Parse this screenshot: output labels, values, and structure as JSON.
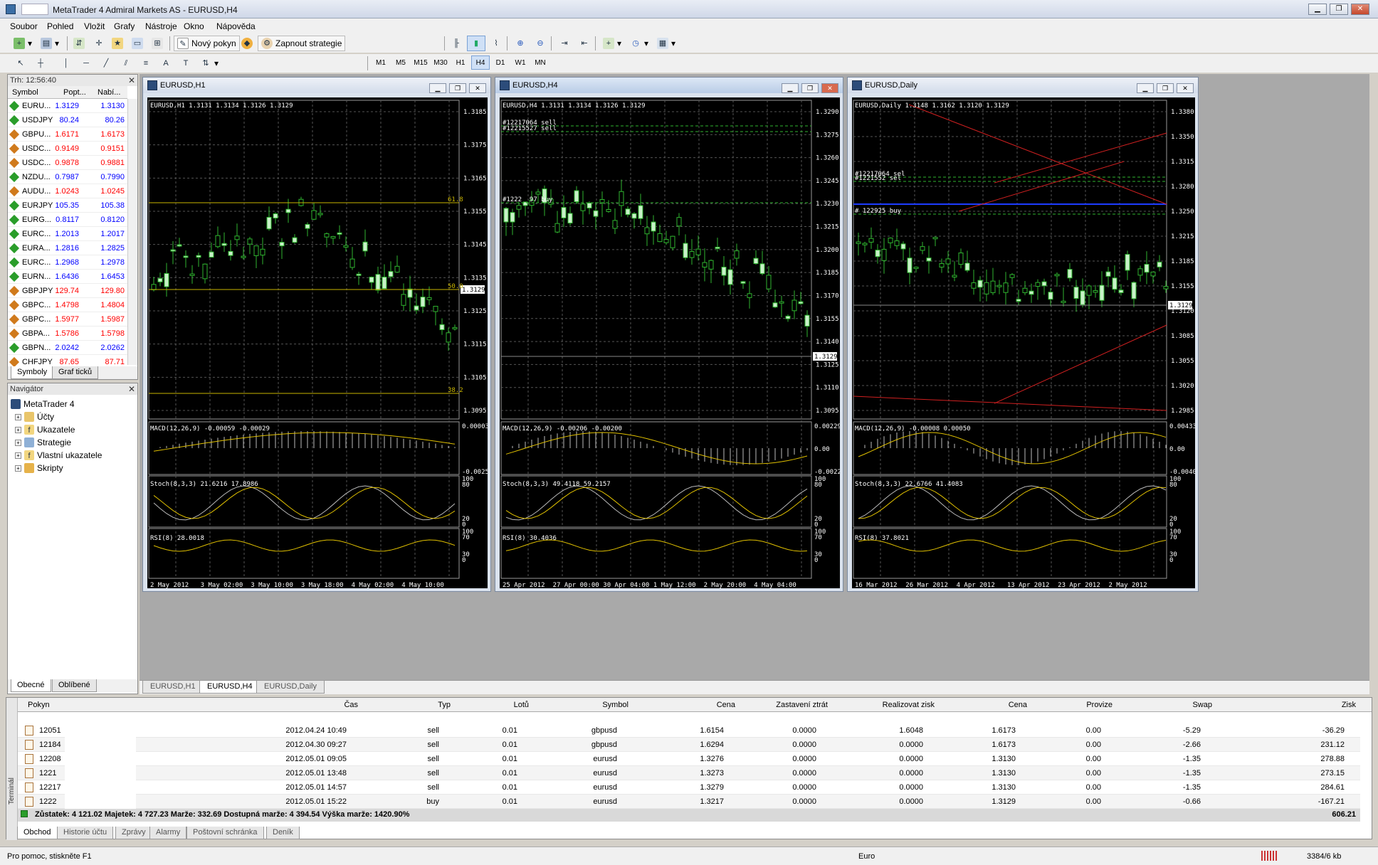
{
  "window": {
    "title": "MetaTrader 4 Admiral Markets AS - EURUSD,H4"
  },
  "menu": [
    "Soubor",
    "Pohled",
    "Vložit",
    "Grafy",
    "Nástroje",
    "Okno",
    "Nápověda"
  ],
  "toolbar": {
    "new_order": "Nový pokyn",
    "strategies": "Zapnout strategie",
    "timeframes": [
      "M1",
      "M5",
      "M15",
      "M30",
      "H1",
      "H4",
      "D1",
      "W1",
      "MN"
    ],
    "active_timeframe": "H4"
  },
  "market_watch": {
    "header": "Trh: 12:56:40",
    "cols": {
      "symbol": "Symbol",
      "bid": "Popt...",
      "ask": "Nabí..."
    },
    "rows": [
      {
        "symbol": "EURU...",
        "bid": "1.3129",
        "ask": "1.3130",
        "dir": "up",
        "color": "#0000ff"
      },
      {
        "symbol": "USDJPY",
        "bid": "80.24",
        "ask": "80.26",
        "dir": "up",
        "color": "#0000ff"
      },
      {
        "symbol": "GBPU...",
        "bid": "1.6171",
        "ask": "1.6173",
        "dir": "down",
        "color": "#ff0000"
      },
      {
        "symbol": "USDC...",
        "bid": "0.9149",
        "ask": "0.9151",
        "dir": "down",
        "color": "#ff0000"
      },
      {
        "symbol": "USDC...",
        "bid": "0.9878",
        "ask": "0.9881",
        "dir": "down",
        "color": "#ff0000"
      },
      {
        "symbol": "NZDU...",
        "bid": "0.7987",
        "ask": "0.7990",
        "dir": "up",
        "color": "#0000ff"
      },
      {
        "symbol": "AUDU...",
        "bid": "1.0243",
        "ask": "1.0245",
        "dir": "down",
        "color": "#ff0000"
      },
      {
        "symbol": "EURJPY",
        "bid": "105.35",
        "ask": "105.38",
        "dir": "up",
        "color": "#0000ff"
      },
      {
        "symbol": "EURG...",
        "bid": "0.8117",
        "ask": "0.8120",
        "dir": "up",
        "color": "#0000ff"
      },
      {
        "symbol": "EURC...",
        "bid": "1.2013",
        "ask": "1.2017",
        "dir": "up",
        "color": "#0000ff"
      },
      {
        "symbol": "EURA...",
        "bid": "1.2816",
        "ask": "1.2825",
        "dir": "up",
        "color": "#0000ff"
      },
      {
        "symbol": "EURC...",
        "bid": "1.2968",
        "ask": "1.2978",
        "dir": "up",
        "color": "#0000ff"
      },
      {
        "symbol": "EURN...",
        "bid": "1.6436",
        "ask": "1.6453",
        "dir": "up",
        "color": "#0000ff"
      },
      {
        "symbol": "GBPJPY",
        "bid": "129.74",
        "ask": "129.80",
        "dir": "down",
        "color": "#ff0000"
      },
      {
        "symbol": "GBPC...",
        "bid": "1.4798",
        "ask": "1.4804",
        "dir": "down",
        "color": "#ff0000"
      },
      {
        "symbol": "GBPC...",
        "bid": "1.5977",
        "ask": "1.5987",
        "dir": "down",
        "color": "#ff0000"
      },
      {
        "symbol": "GBPA...",
        "bid": "1.5786",
        "ask": "1.5798",
        "dir": "down",
        "color": "#ff0000"
      },
      {
        "symbol": "GBPN...",
        "bid": "2.0242",
        "ask": "2.0262",
        "dir": "up",
        "color": "#0000ff"
      },
      {
        "symbol": "CHFJPY",
        "bid": "87.65",
        "ask": "87.71",
        "dir": "down",
        "color": "#ff0000"
      }
    ],
    "tabs": [
      "Symboly",
      "Graf ticků"
    ]
  },
  "navigator": {
    "header": "Navigátor",
    "root": "MetaTrader 4",
    "items": [
      "Účty",
      "Ukazatele",
      "Strategie",
      "Vlastní ukazatele",
      "Skripty"
    ],
    "tabs": [
      "Obecné",
      "Oblíbené"
    ]
  },
  "charts": [
    {
      "title": "EURUSD,H1",
      "info": "EURUSD,H1  1.3131 1.3134 1.3126 1.3129",
      "price_labels": [
        "1.3185",
        "1.3175",
        "1.3165",
        "1.3155",
        "1.3145",
        "1.3135",
        "1.3125",
        "1.3115",
        "1.3105",
        "1.3095"
      ],
      "current": "1.3129",
      "fib": [
        "61.8",
        "50.0",
        "38.2"
      ],
      "macd": "MACD(12,26,9) -0.00059 -0.00029",
      "macd_labels": [
        "0.00003",
        "-0.00251"
      ],
      "stoch": "Stoch(8,3,3) 21.6216 17.8986",
      "rsi": "RSI(8) 28.0018",
      "dates": [
        "2 May 2012",
        "3 May 02:00",
        "3 May 10:00",
        "3 May 18:00",
        "4 May 02:00",
        "4 May 10:00"
      ],
      "orders": []
    },
    {
      "title": "EURUSD,H4",
      "info": "EURUSD,H4  1.3131 1.3134 1.3126 1.3129",
      "price_labels": [
        "1.3290",
        "1.3275",
        "1.3260",
        "1.3245",
        "1.3230",
        "1.3215",
        "1.3200",
        "1.3185",
        "1.3170",
        "1.3155",
        "1.3140",
        "1.3125",
        "1.3110",
        "1.3095"
      ],
      "current": "1.3129",
      "fib": [],
      "macd": "MACD(12,26,9) -0.00206 -0.00200",
      "macd_labels": [
        "0.00229",
        "0.00",
        "-0.00228"
      ],
      "stoch": "Stoch(8,3,3) 49.4118 59.2157",
      "rsi": "RSI(8) 30.4036",
      "dates": [
        "25 Apr 2012",
        "27 Apr 00:00",
        "30 Apr 04:00",
        "1 May 12:00",
        "2 May 20:00",
        "4 May 04:00"
      ],
      "orders": [
        "#12217064 sell",
        "#12215527 sell",
        "#1222  97 buy"
      ]
    },
    {
      "title": "EURUSD,Daily",
      "info": "EURUSD,Daily  1.3148 1.3162 1.3120 1.3129",
      "price_labels": [
        "1.3380",
        "1.3350",
        "1.3315",
        "1.3280",
        "1.3250",
        "1.3215",
        "1.3185",
        "1.3155",
        "1.3120",
        "1.3085",
        "1.3055",
        "1.3020",
        "1.2985"
      ],
      "current": "1.3129",
      "fib": [],
      "macd": "MACD(12,26,9) -0.00008 0.00050",
      "macd_labels": [
        "0.00433",
        "0.00",
        "-0.00406"
      ],
      "stoch": "Stoch(8,3,3) 22.6766 41.4083",
      "rsi": "RSI(8) 37.8021",
      "dates": [
        "16 Mar 2012",
        "26 Mar 2012",
        "4 Apr 2012",
        "13 Apr 2012",
        "23 Apr 2012",
        "2 May 2012"
      ],
      "orders": [
        "#12217064 sel",
        "#1221552 sel",
        "# 122925 buy"
      ]
    }
  ],
  "chart_tabs": [
    "EURUSD,H1",
    "EURUSD,H4",
    "EURUSD,Daily"
  ],
  "indicator_levels": {
    "stoch": [
      "100",
      "80",
      "20",
      "0"
    ],
    "rsi": [
      "100",
      "70",
      "30",
      "0"
    ]
  },
  "terminal": {
    "side_label": "Terminál",
    "cols": [
      "Pokyn",
      "Čas",
      "Typ",
      "Lotů",
      "Symbol",
      "Cena",
      "Zastavení ztrát",
      "Realizovat zisk",
      "Cena",
      "Provize",
      "Swap",
      "Zisk"
    ],
    "rows": [
      [
        "12051",
        "2012.04.24 10:49",
        "sell",
        "0.01",
        "gbpusd",
        "1.6154",
        "0.0000",
        "1.6048",
        "1.6173",
        "0.00",
        "-5.29",
        "-36.29"
      ],
      [
        "12184",
        "2012.04.30 09:27",
        "sell",
        "0.01",
        "gbpusd",
        "1.6294",
        "0.0000",
        "0.0000",
        "1.6173",
        "0.00",
        "-2.66",
        "231.12"
      ],
      [
        "12208",
        "2012.05.01 09:05",
        "sell",
        "0.01",
        "eurusd",
        "1.3276",
        "0.0000",
        "0.0000",
        "1.3130",
        "0.00",
        "-1.35",
        "278.88"
      ],
      [
        "1221 ",
        "2012.05.01 13:48",
        "sell",
        "0.01",
        "eurusd",
        "1.3273",
        "0.0000",
        "0.0000",
        "1.3130",
        "0.00",
        "-1.35",
        "273.15"
      ],
      [
        "12217",
        "2012.05.01 14:57",
        "sell",
        "0.01",
        "eurusd",
        "1.3279",
        "0.0000",
        "0.0000",
        "1.3130",
        "0.00",
        "-1.35",
        "284.61"
      ],
      [
        "1222 ",
        "2012.05.01 15:22",
        "buy",
        "0.01",
        "eurusd",
        "1.3217",
        "0.0000",
        "0.0000",
        "1.3129",
        "0.00",
        "-0.66",
        "-167.21"
      ]
    ],
    "summary": "Zůstatek: 4 121.02  Majetek: 4 727.23  Marže: 332.69  Dostupná marže: 4 394.54  Výška marže: 1420.90%",
    "summary_total": "606.21",
    "tabs": [
      "Obchod",
      "Historie účtu",
      "Zprávy",
      "Alarmy",
      "Poštovní schránka",
      "Deník"
    ]
  },
  "status": {
    "help": "Pro pomoc, stiskněte F1",
    "profile": "Euro",
    "traffic": "3384/6 kb"
  }
}
